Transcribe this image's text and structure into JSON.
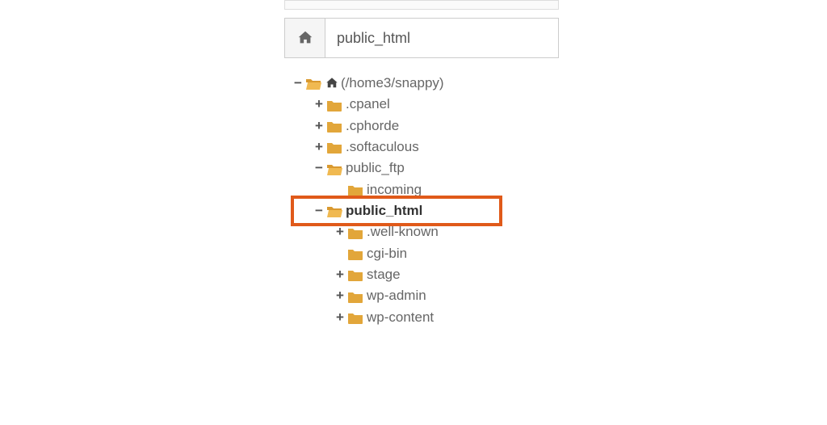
{
  "breadcrumb": {
    "path": "public_html"
  },
  "toggles": {
    "minus": "−",
    "plus": "+"
  },
  "tree": {
    "root": {
      "label": "(/home3/snappy)",
      "expanded": true
    },
    "items_l2": [
      {
        "label": ".cpanel",
        "expanded": false,
        "hasChildren": true
      },
      {
        "label": ".cphorde",
        "expanded": false,
        "hasChildren": true
      },
      {
        "label": ".softaculous",
        "expanded": false,
        "hasChildren": true
      },
      {
        "label": "public_ftp",
        "expanded": true,
        "hasChildren": true
      }
    ],
    "public_ftp_children": [
      {
        "label": "incoming",
        "hasChildren": false
      }
    ],
    "public_html": {
      "label": "public_html",
      "expanded": true
    },
    "public_html_children": [
      {
        "label": ".well-known",
        "hasChildren": true
      },
      {
        "label": "cgi-bin",
        "hasChildren": false
      },
      {
        "label": "stage",
        "hasChildren": true
      },
      {
        "label": "wp-admin",
        "hasChildren": true
      },
      {
        "label": "wp-content",
        "hasChildren": true
      }
    ]
  },
  "colors": {
    "highlight": "#e05a1a",
    "folder": "#e2a63a"
  }
}
